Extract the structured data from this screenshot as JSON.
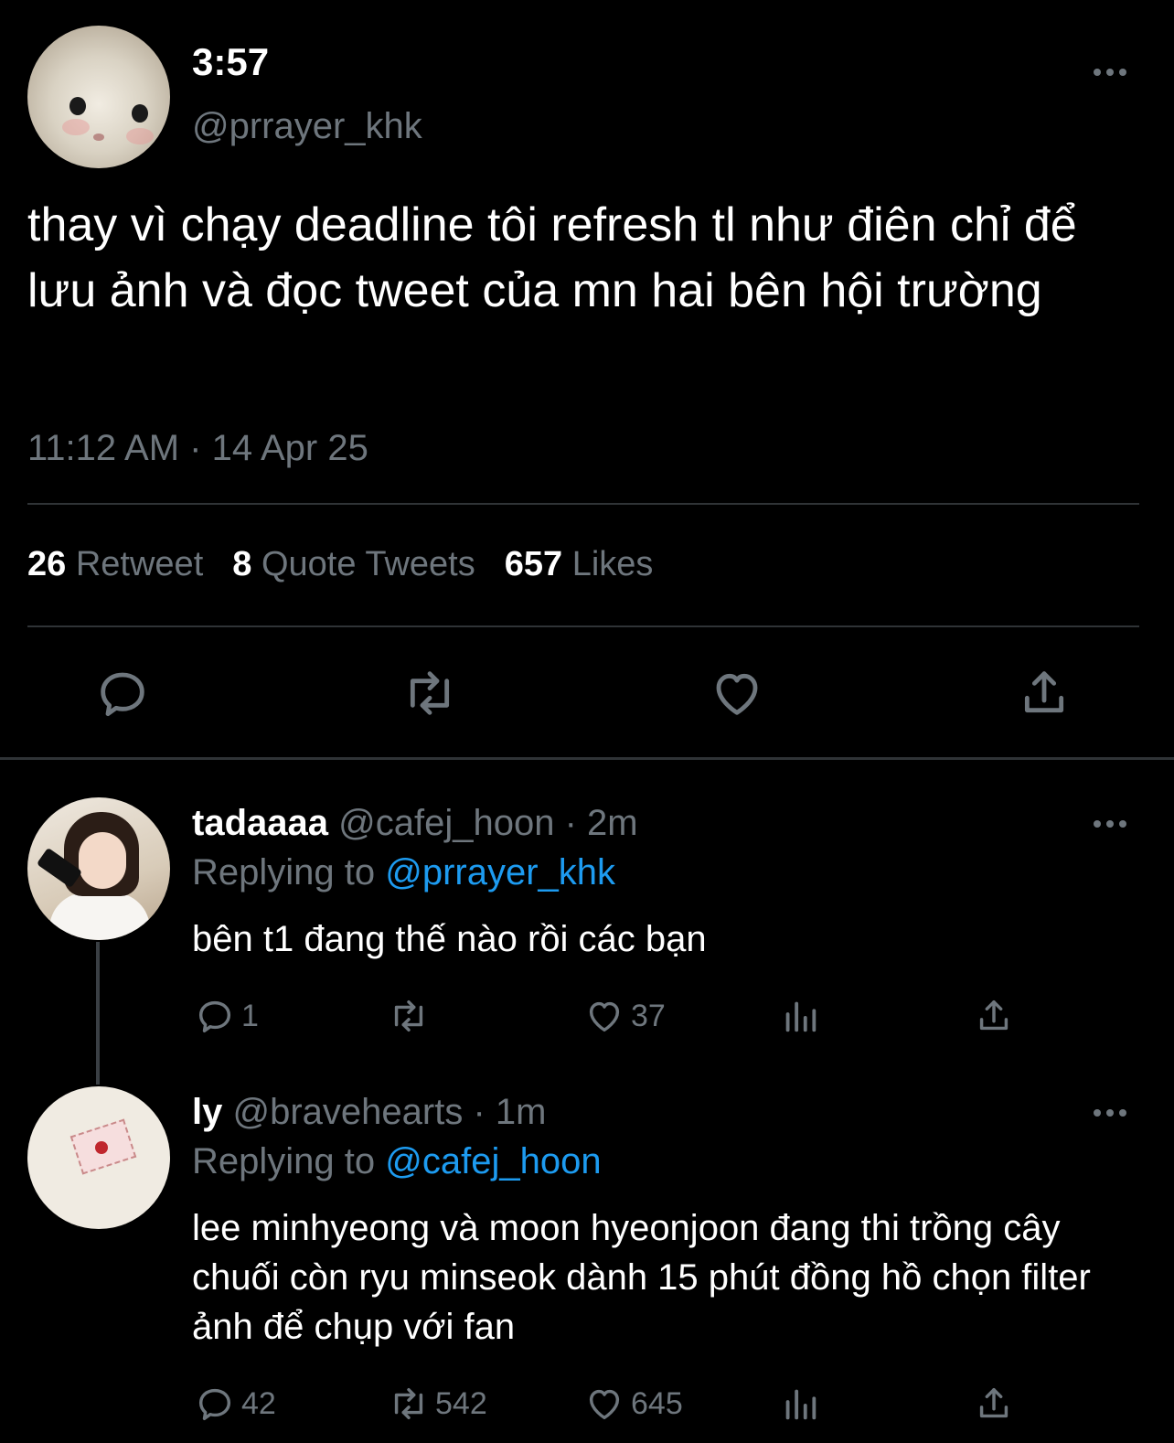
{
  "main_tweet": {
    "display_name": "3:57",
    "handle": "@prrayer_khk",
    "text": "thay vì chạy deadline tôi refresh tl như điên chỉ để lưu ảnh và đọc tweet của mn hai bên hội trường",
    "timestamp": "11:12 AM · 14 Apr 25",
    "stats": {
      "retweets_count": "26",
      "retweets_label": "Retweet",
      "quotes_count": "8",
      "quotes_label": "Quote Tweets",
      "likes_count": "657",
      "likes_label": "Likes"
    },
    "actions": [
      "reply-icon",
      "retweet-icon",
      "like-icon",
      "share-icon"
    ]
  },
  "replies": [
    {
      "display_name": "tadaaaa",
      "handle": "@cafej_hoon",
      "time": "· 2m",
      "replying_label": "Replying to",
      "replying_to": "@prrayer_khk",
      "text": "bên t1 đang thế nào rồi các bạn",
      "reply_count": "1",
      "retweet_count": "",
      "like_count": "37"
    },
    {
      "display_name": "ly",
      "handle": "@bravehearts",
      "time": "· 1m",
      "replying_label": "Replying to",
      "replying_to": "@cafej_hoon",
      "text": "lee minhyeong và moon hyeonjoon đang thi trồng cây chuối còn ryu minseok dành 15 phút đồng hồ chọn filter ảnh để chụp với fan",
      "reply_count": "42",
      "retweet_count": "542",
      "like_count": "645"
    }
  ],
  "colors": {
    "background": "#000000",
    "text": "#ffffff",
    "muted": "#6e767d",
    "link": "#1d9bf0",
    "divider": "#2f3336"
  }
}
